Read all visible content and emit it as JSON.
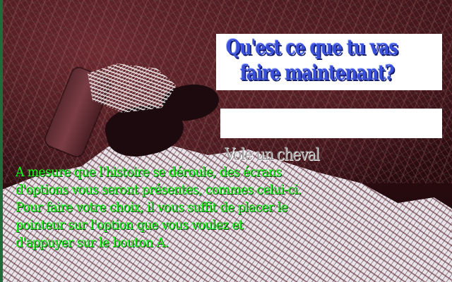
{
  "title": {
    "line1": "Qu'est ce que tu vas",
    "line2": "faire maintenant?"
  },
  "options": [
    {
      "label": ""
    },
    {
      "label": "Vole un cheval"
    }
  ],
  "narration": {
    "lines": [
      "A mesure que l'histoire se déroule, des écrans",
      "d'options vous seront présentes, commes celui-ci.",
      "Pour faire votre choix, il vous suffit de placer le",
      "pointeur sur l'option que vous voulez et",
      "d'appuyer sur le bouton A."
    ]
  },
  "colors": {
    "title_text": "#3a4fd8",
    "narration_text": "#1cff1c",
    "option_text": "#9a9a9a",
    "panel_bg": "#ffffff"
  }
}
